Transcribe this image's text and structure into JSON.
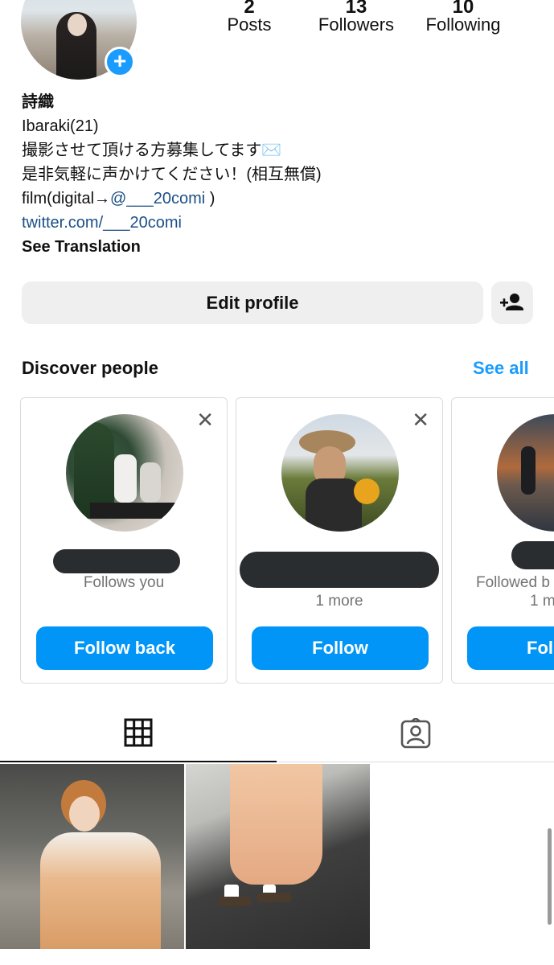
{
  "profile": {
    "name": "詩織",
    "bio_lines": [
      "Ibaraki(21)",
      "撮影させて頂ける方募集してます✉️",
      "是非気軽に声かけてください！(相互無償)"
    ],
    "film_prefix": "film(digital→",
    "film_mention": "@___20comi",
    "film_suffix": " )",
    "link": "twitter.com/___20comi",
    "see_translation": "See Translation"
  },
  "stats": [
    {
      "value": "2",
      "label": "Posts"
    },
    {
      "value": "13",
      "label": "Followers"
    },
    {
      "value": "10",
      "label": "Following"
    }
  ],
  "actions": {
    "edit_profile": "Edit profile",
    "add_person_icon": "person-add-icon"
  },
  "discover": {
    "title": "Discover people",
    "see_all": "See all",
    "cards": [
      {
        "subtitle": "Follows you",
        "subtitle2": "",
        "button": "Follow back"
      },
      {
        "subtitle": "",
        "subtitle2": "1 more",
        "button": "Follow"
      },
      {
        "subtitle": "Followed b",
        "subtitle2": "1 m",
        "button": "Fol"
      }
    ]
  },
  "tabs": [
    {
      "icon": "grid-icon",
      "active": true
    },
    {
      "icon": "tagged-person-icon",
      "active": false
    }
  ],
  "colors": {
    "accent": "#0095f6",
    "link": "#1c4f86",
    "button_bg": "#efefef",
    "redaction": "#2a2d30"
  }
}
